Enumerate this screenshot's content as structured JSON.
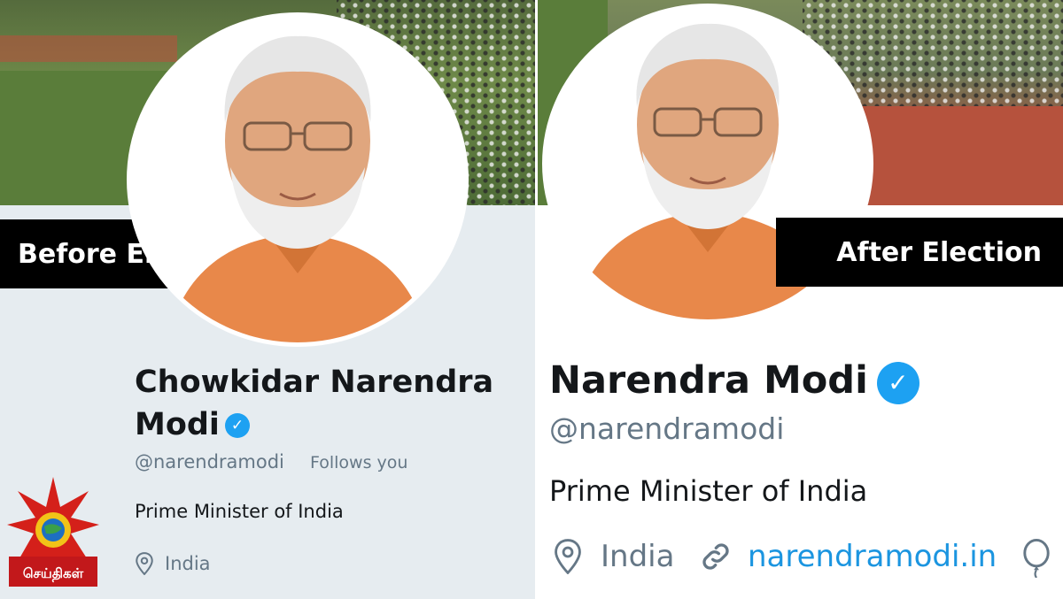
{
  "before": {
    "tag": "Before Election",
    "name_line1": "Chowkidar Narendra",
    "name_line2": "Modi",
    "handle": "@narendramodi",
    "follows_you": "Follows you",
    "bio": "Prime Minister of India",
    "location": "India"
  },
  "after": {
    "tag": "After Election",
    "name": "Narendra Modi",
    "handle": "@narendramodi",
    "bio": "Prime Minister of India",
    "location": "India",
    "website": "narendramodi.in"
  },
  "logo": {
    "text": "செய்திகள்"
  },
  "icons": {
    "verified": "verified-badge-icon",
    "location": "location-pin-icon",
    "link": "link-icon",
    "birthday": "balloon-icon"
  },
  "colors": {
    "twitter_blue": "#1da1f2",
    "link_blue": "#1b95e0",
    "saffron": "#e8884a",
    "tag_bg": "#000000"
  }
}
